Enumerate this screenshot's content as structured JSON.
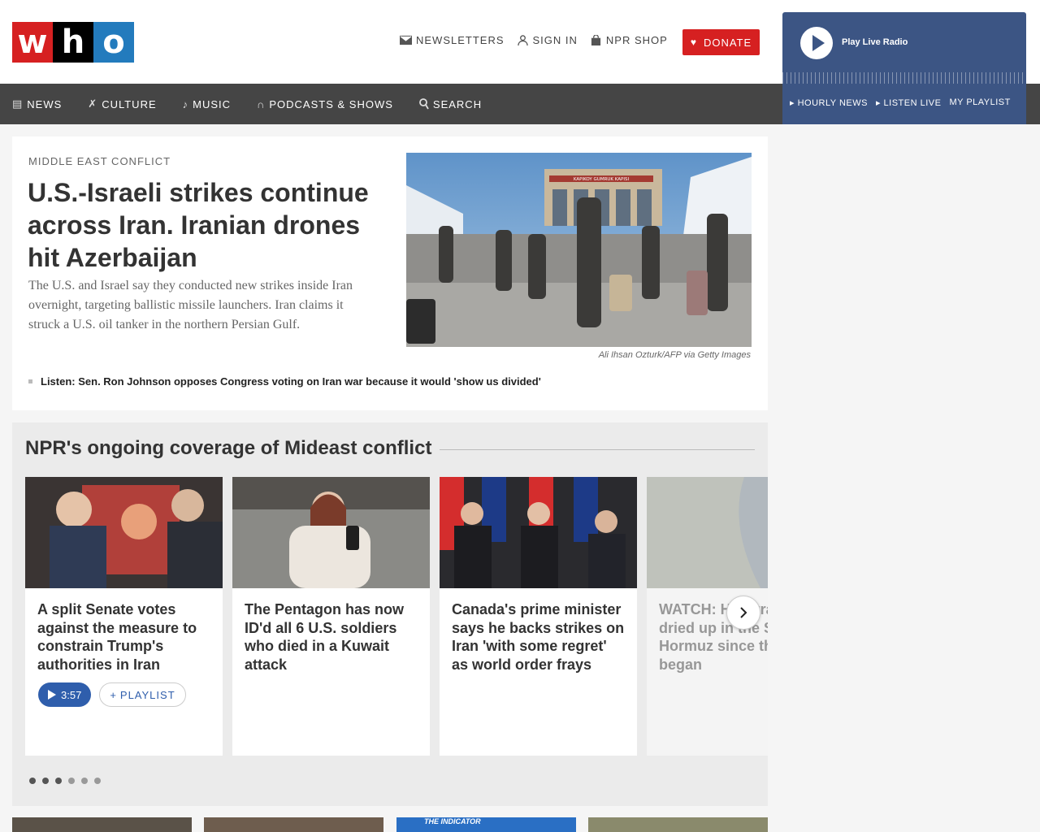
{
  "logo": {
    "letters": [
      "w",
      "h",
      "o"
    ]
  },
  "header": {
    "links": [
      {
        "label": "NEWSLETTERS",
        "icon": "mail-icon"
      },
      {
        "label": "SIGN IN",
        "icon": "user-icon"
      },
      {
        "label": "NPR SHOP",
        "icon": "shopping-bag-icon"
      }
    ],
    "donate_label": "DONATE"
  },
  "player": {
    "live_label": "Play Live Radio",
    "links": [
      "HOURLY NEWS",
      "LISTEN LIVE",
      "MY PLAYLIST"
    ]
  },
  "nav": {
    "items": [
      {
        "label": "NEWS",
        "icon": "news-icon"
      },
      {
        "label": "CULTURE",
        "icon": "culture-icon"
      },
      {
        "label": "MUSIC",
        "icon": "music-note-icon"
      },
      {
        "label": "PODCASTS & SHOWS",
        "icon": "headphones-icon"
      },
      {
        "label": "SEARCH",
        "icon": "search-icon"
      }
    ]
  },
  "lead": {
    "kicker": "MIDDLE EAST CONFLICT",
    "headline": "U.S.-Israeli strikes continue across Iran. Iranian drones hit Azerbaijan",
    "teaser": "The U.S. and Israel say they conducted new strikes inside Iran overnight, targeting ballistic missile launchers. Iran claims it struck a U.S. oil tanker in the northern Persian Gulf.",
    "photo_sign": "KAPIKOY GUMRUK KAPISI",
    "credit": "Ali Ihsan Ozturk/AFP via Getty Images",
    "related": "Listen: Sen. Ron Johnson opposes Congress voting on Iran war because it would 'show us divided'"
  },
  "coverage": {
    "title": "NPR's ongoing coverage of Mideast conflict",
    "cards": [
      {
        "title": "A split Senate votes against the measure to constrain Trump's authorities in Iran",
        "duration": "3:57",
        "playlist_label": "PLAYLIST"
      },
      {
        "title": "The Pentagon has now ID'd all 6 U.S. soldiers who died in a Kuwait attack"
      },
      {
        "title": "Canada's prime minister says he backs strikes on Iran 'with some regret' as world order frays"
      },
      {
        "title": "WATCH: How traffic has dried up in the Strait of Hormuz since the war began"
      }
    ],
    "dots": 6,
    "active_dots": 3
  },
  "bottom": {
    "strip_text": "THE INDICATOR"
  },
  "colors": {
    "brand_red": "#d62021",
    "brand_blue": "#237bbd",
    "player_blue": "#3c5584",
    "nav_bg": "#454545",
    "play_blue": "#2f5eac"
  }
}
